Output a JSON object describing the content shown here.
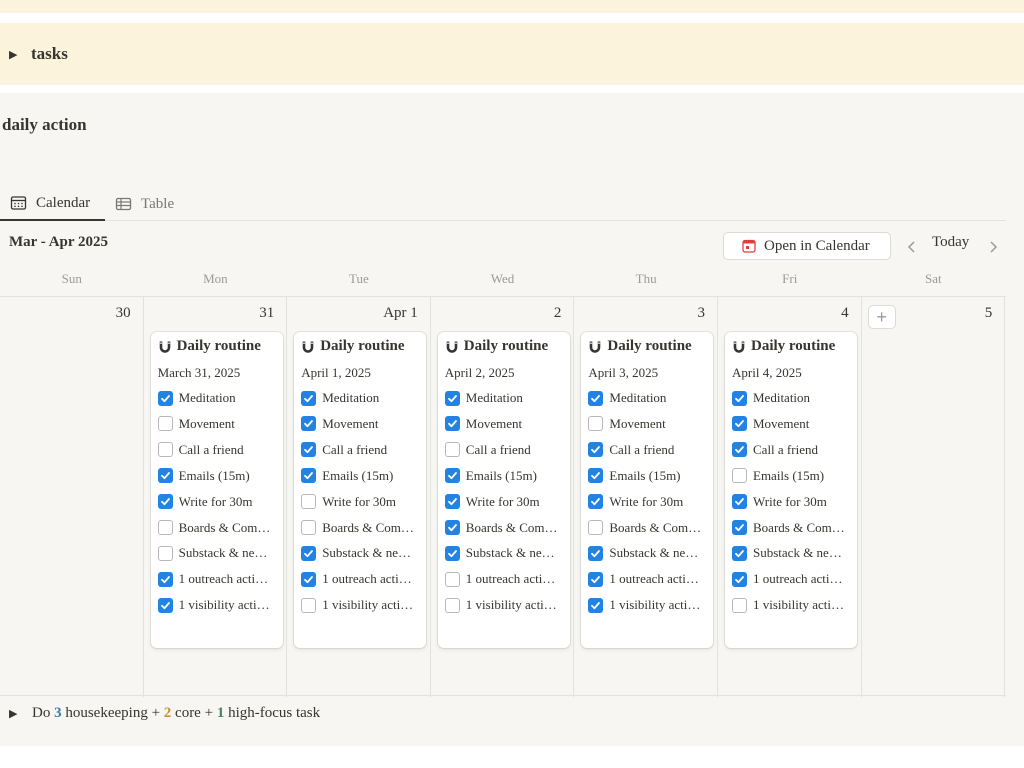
{
  "tasks_toggle": {
    "label": "tasks"
  },
  "database": {
    "title": "daily action",
    "tabs": [
      {
        "label": "Calendar",
        "icon": "calendar-icon"
      },
      {
        "label": "Table",
        "icon": "table-icon"
      }
    ],
    "range_label": "Mar - Apr 2025",
    "open_calendar_label": "Open in Calendar",
    "today_label": "Today"
  },
  "weekdays": [
    "Sun",
    "Mon",
    "Tue",
    "Wed",
    "Thu",
    "Fri",
    "Sat"
  ],
  "days": [
    {
      "num": "30",
      "card": null
    },
    {
      "num": "31",
      "card": {
        "title": "Daily routine",
        "date": "March 31, 2025",
        "items": [
          {
            "label": "Meditation",
            "checked": true
          },
          {
            "label": "Movement",
            "checked": false
          },
          {
            "label": "Call a friend",
            "checked": false
          },
          {
            "label": "Emails (15m)",
            "checked": true
          },
          {
            "label": "Write for 30m",
            "checked": true
          },
          {
            "label": "Boards & Com…",
            "checked": false
          },
          {
            "label": "Substack & ne…",
            "checked": false
          },
          {
            "label": "1 outreach acti…",
            "checked": true
          },
          {
            "label": "1 visibility acti…",
            "checked": true
          }
        ]
      }
    },
    {
      "num": "Apr 1",
      "card": {
        "title": "Daily routine",
        "date": "April 1, 2025",
        "items": [
          {
            "label": "Meditation",
            "checked": true
          },
          {
            "label": "Movement",
            "checked": true
          },
          {
            "label": "Call a friend",
            "checked": true
          },
          {
            "label": "Emails (15m)",
            "checked": true
          },
          {
            "label": "Write for 30m",
            "checked": false
          },
          {
            "label": "Boards & Com…",
            "checked": false
          },
          {
            "label": "Substack & ne…",
            "checked": true
          },
          {
            "label": "1 outreach acti…",
            "checked": true
          },
          {
            "label": "1 visibility acti…",
            "checked": false
          }
        ]
      }
    },
    {
      "num": "2",
      "card": {
        "title": "Daily routine",
        "date": "April 2, 2025",
        "items": [
          {
            "label": "Meditation",
            "checked": true
          },
          {
            "label": "Movement",
            "checked": true
          },
          {
            "label": "Call a friend",
            "checked": false
          },
          {
            "label": "Emails (15m)",
            "checked": true
          },
          {
            "label": "Write for 30m",
            "checked": true
          },
          {
            "label": "Boards & Com…",
            "checked": true
          },
          {
            "label": "Substack & ne…",
            "checked": true
          },
          {
            "label": "1 outreach acti…",
            "checked": false
          },
          {
            "label": "1 visibility acti…",
            "checked": false
          }
        ]
      }
    },
    {
      "num": "3",
      "card": {
        "title": "Daily routine",
        "date": "April 3, 2025",
        "items": [
          {
            "label": "Meditation",
            "checked": true
          },
          {
            "label": "Movement",
            "checked": false
          },
          {
            "label": "Call a friend",
            "checked": true
          },
          {
            "label": "Emails (15m)",
            "checked": true
          },
          {
            "label": "Write for 30m",
            "checked": true
          },
          {
            "label": "Boards & Com…",
            "checked": false
          },
          {
            "label": "Substack & ne…",
            "checked": true
          },
          {
            "label": "1 outreach acti…",
            "checked": true
          },
          {
            "label": "1 visibility acti…",
            "checked": true
          }
        ]
      }
    },
    {
      "num": "4",
      "card": {
        "title": "Daily routine",
        "date": "April 4, 2025",
        "items": [
          {
            "label": "Meditation",
            "checked": true
          },
          {
            "label": "Movement",
            "checked": true
          },
          {
            "label": "Call a friend",
            "checked": true
          },
          {
            "label": "Emails (15m)",
            "checked": false
          },
          {
            "label": "Write for 30m",
            "checked": true
          },
          {
            "label": "Boards & Com…",
            "checked": true
          },
          {
            "label": "Substack & ne…",
            "checked": true
          },
          {
            "label": "1 outreach acti…",
            "checked": true
          },
          {
            "label": "1 visibility acti…",
            "checked": false
          }
        ]
      }
    },
    {
      "num": "5",
      "card": null,
      "add_button": "+"
    }
  ],
  "footer": {
    "prefix": "Do",
    "n1": "3",
    "t1": "housekeeping +",
    "n2": "2",
    "t2": "core +",
    "n3": "1",
    "t3": "high-focus task"
  },
  "colors": {
    "checkbox_on": "#2383e2",
    "banner": "#fbf3db",
    "n1": "#337ea9",
    "n2": "#cb912f",
    "n3": "#448361"
  }
}
